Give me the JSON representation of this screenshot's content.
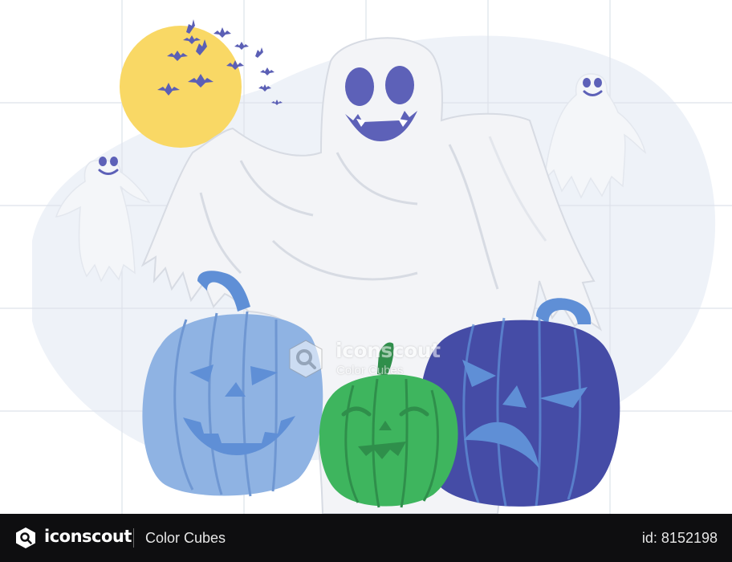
{
  "watermark": {
    "brand": "iconscout",
    "collection": "Color Cubes"
  },
  "footer": {
    "brand": "iconscout",
    "collection": "Color Cubes",
    "asset_id": "id: 8152198"
  },
  "illustration": {
    "subject": "Halloween ghost with pumpkins",
    "colors": {
      "moon": "#f9d865",
      "bats": "#5b5fb5",
      "ghost_body": "#f3f4f7",
      "ghost_shadow": "#dcdfe6",
      "ghost_face": "#5d61b8",
      "pumpkin_light_blue": "#8fb3e3",
      "pumpkin_green": "#3eb55e",
      "pumpkin_navy": "#454ca6",
      "stem_blue": "#5f8fd6",
      "background_blob": "#eef2f8",
      "grid_line": "#d8dde6"
    }
  }
}
